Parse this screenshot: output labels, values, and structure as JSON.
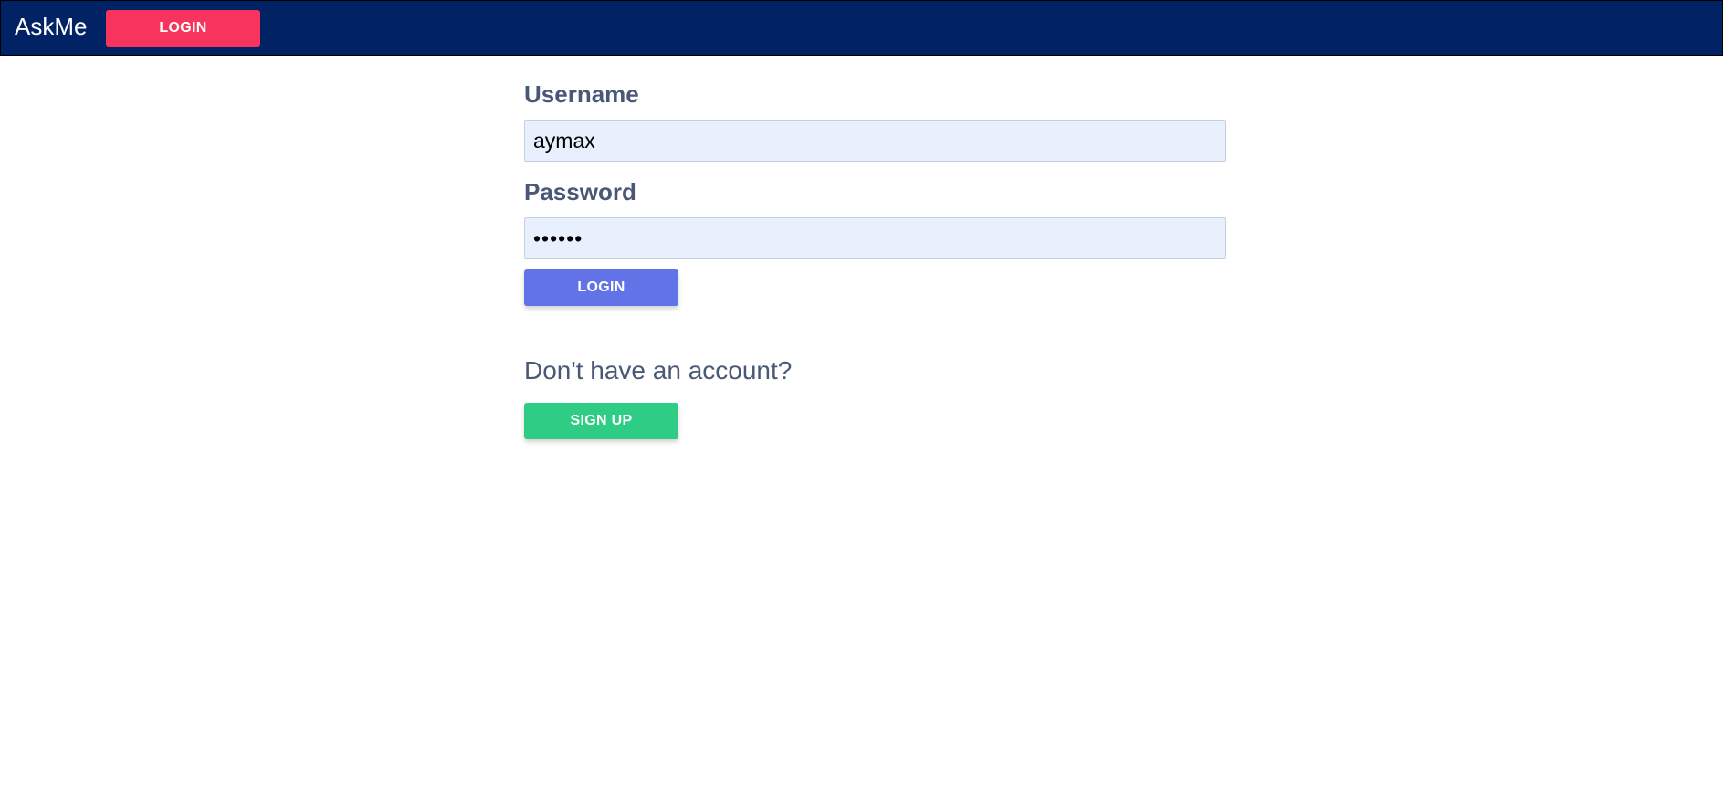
{
  "navbar": {
    "brand": "AskMe",
    "login_label": "LOGIN",
    "bg_color": "#012365",
    "login_color": "#f7345e"
  },
  "form": {
    "username_label": "Username",
    "username_value": "aymax",
    "password_label": "Password",
    "password_value": "••••••",
    "login_label": "LOGIN",
    "login_color": "#6173e6"
  },
  "signup": {
    "prompt": "Don't have an account?",
    "button_label": "SIGN UP",
    "button_color": "#2ecc85"
  }
}
